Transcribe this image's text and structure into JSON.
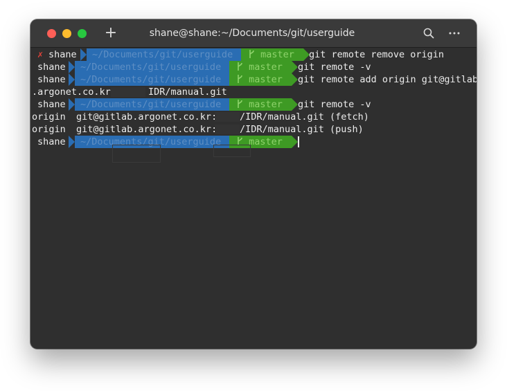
{
  "window": {
    "title": "shane@shane:~/Documents/git/userguide",
    "new_tab_label": "+"
  },
  "prompt": {
    "user": "shane",
    "path": "~/Documents/git/userguide",
    "branch": "master",
    "branch_icon": "git-branch-icon",
    "error_mark": "✗"
  },
  "lines": {
    "cmd1": "git remote remove origin",
    "cmd2": "git remote -v",
    "cmd3": "git remote add origin git@gitlab",
    "cmd3_cont_a": ".argonet.co.kr",
    "cmd3_cont_b": "IDR/manual.git",
    "cmd4": "git remote -v",
    "out1_name": "origin",
    "out1_host": "git@gitlab.argonet.co.kr:",
    "out1_rest": "/IDR/manual.git (fetch)",
    "out2_name": "origin",
    "out2_host": "git@gitlab.argonet.co.kr:",
    "out2_rest": "/IDR/manual.git (push)"
  },
  "colors": {
    "window_bg": "#2f2f2f",
    "path_segment": "#2a6db3",
    "branch_segment": "#3e9a24",
    "error": "#e0433a"
  }
}
